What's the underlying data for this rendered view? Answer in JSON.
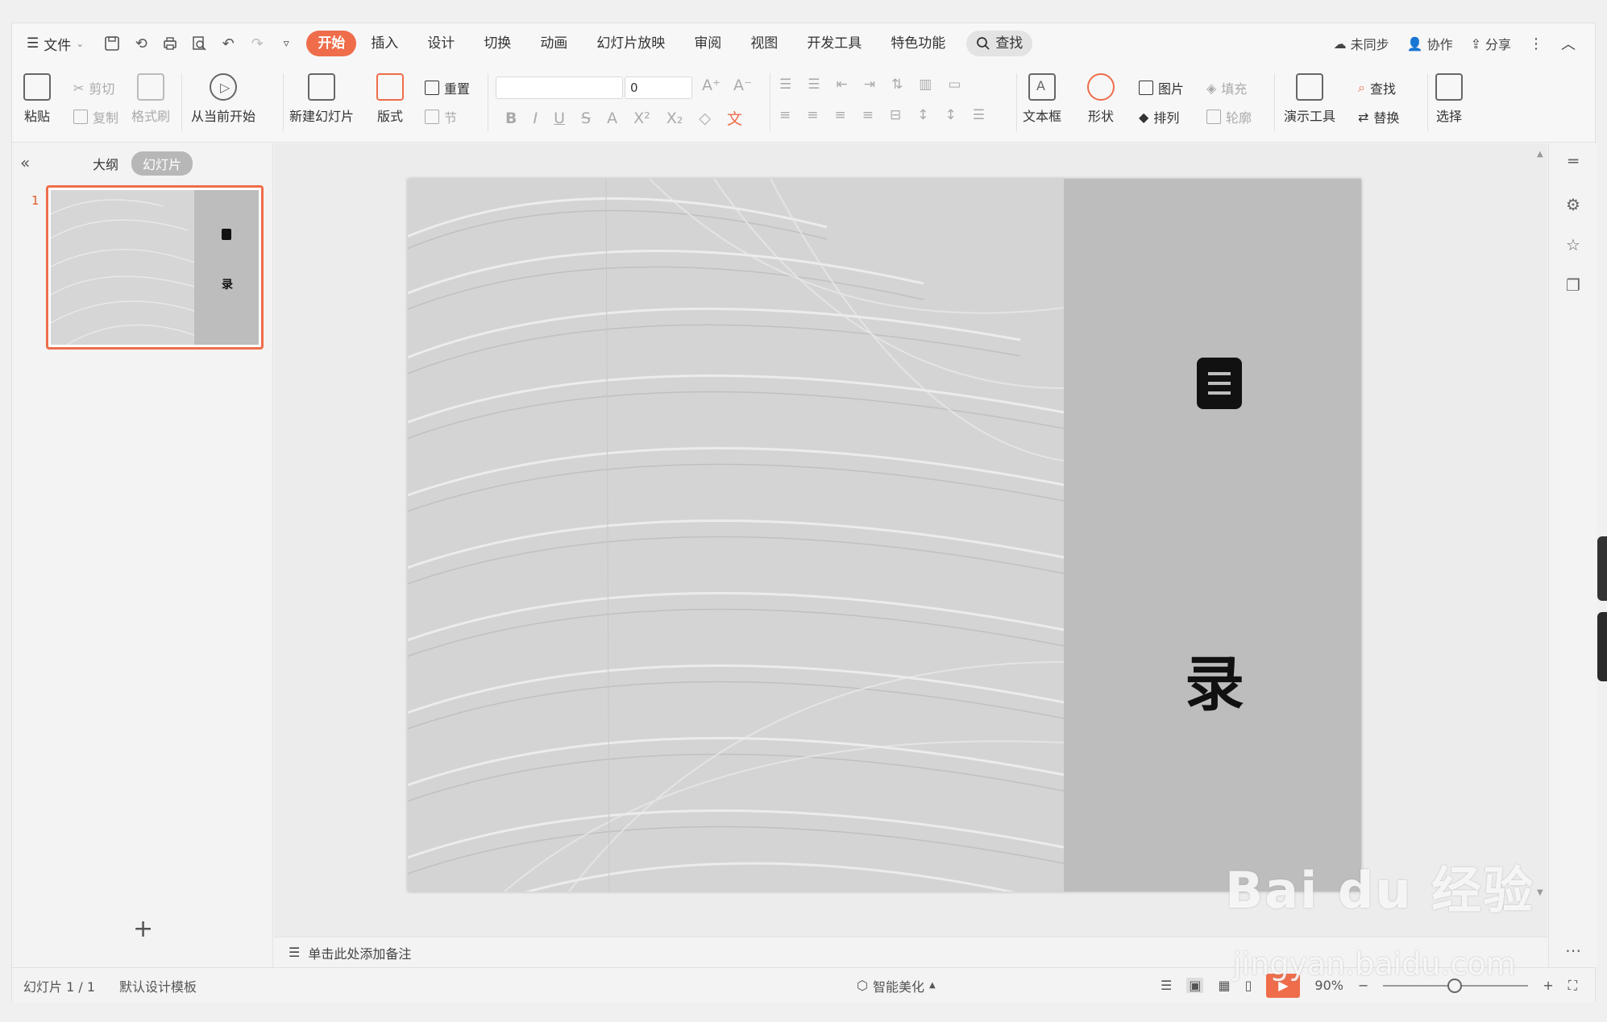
{
  "menubar": {
    "file_label": "文件",
    "tabs": [
      "开始",
      "插入",
      "设计",
      "切换",
      "动画",
      "幻灯片放映",
      "审阅",
      "视图",
      "开发工具",
      "特色功能"
    ],
    "active_tab": "开始",
    "search_label": "查找",
    "right_actions": [
      "未同步",
      "协作",
      "分享"
    ]
  },
  "ribbon": {
    "paste": "粘贴",
    "cut": "剪切",
    "copy": "复制",
    "format_painter": "格式刷",
    "from_current": "从当前开始",
    "new_slide": "新建幻灯片",
    "layout": "版式",
    "reset": "重置",
    "section": "节",
    "font_size_value": "0",
    "text_box": "文本框",
    "shape": "形状",
    "picture": "图片",
    "fill": "填充",
    "arrange": "排列",
    "outline": "轮廓",
    "present_tools": "演示工具",
    "find": "查找",
    "replace": "替换",
    "select": "选择"
  },
  "left_panel": {
    "outline_tab": "大纲",
    "slides_tab": "幻灯片",
    "slide_number": "1"
  },
  "slide": {
    "char_top": "目",
    "char_bottom": "录"
  },
  "notes": {
    "placeholder": "单击此处添加备注"
  },
  "statusbar": {
    "slide_info": "幻灯片 1 / 1",
    "template": "默认设计模板",
    "beautify": "智能美化",
    "zoom": "90%"
  },
  "watermark": {
    "brand": "Bai du 经验",
    "url": "jingyan.baidu.com"
  },
  "colors": {
    "accent": "#ef6d4a",
    "slide_gray": "#bdbdbd"
  }
}
